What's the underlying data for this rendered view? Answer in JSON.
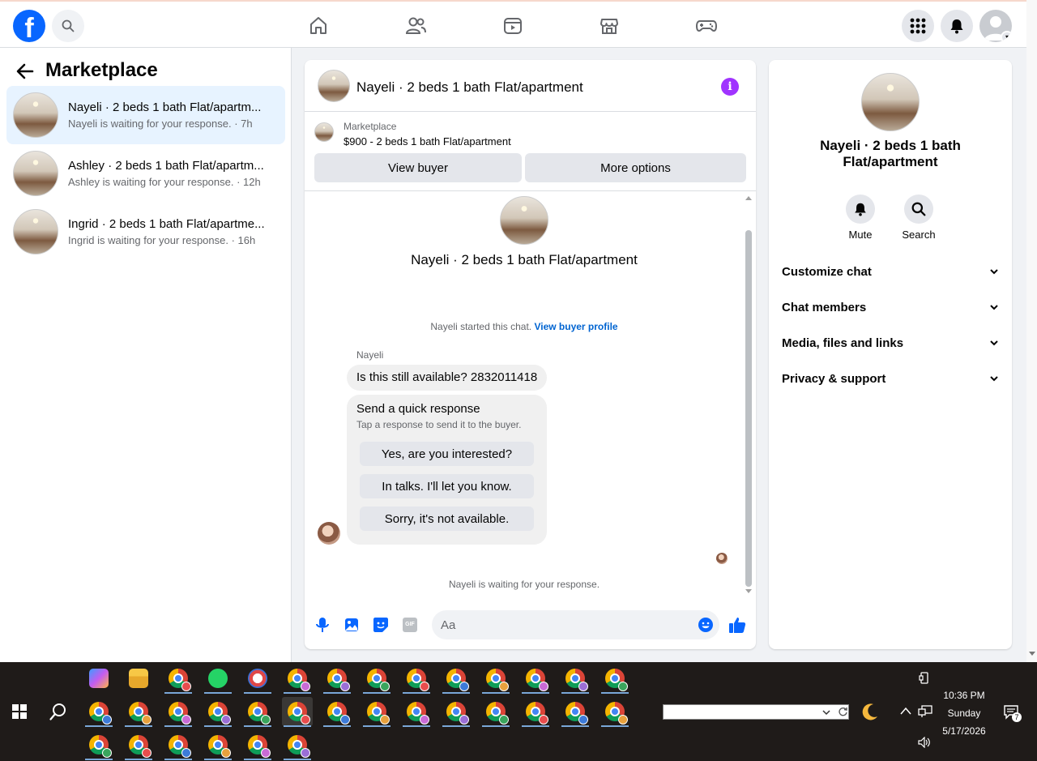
{
  "topbar": {
    "logo_letter": "f",
    "nav": [
      "home-icon",
      "friends-icon",
      "video-icon",
      "marketplace-icon",
      "gaming-icon"
    ]
  },
  "left": {
    "title": "Marketplace",
    "conversations": [
      {
        "title": "Nayeli · 2 beds 1 bath Flat/apartm...",
        "subtitle": "Nayeli is waiting for your response. · 7h",
        "active": true
      },
      {
        "title": "Ashley · 2 beds 1 bath Flat/apartm...",
        "subtitle": "Ashley is waiting for your response. · 12h",
        "active": false
      },
      {
        "title": "Ingrid · 2 beds 1 bath Flat/apartme...",
        "subtitle": "Ingrid is waiting for your response. · 16h",
        "active": false
      }
    ]
  },
  "chat": {
    "header_title": "Nayeli · 2 beds 1 bath Flat/apartment",
    "marketplace_label": "Marketplace",
    "listing": "$900 - 2 beds 1 bath Flat/apartment",
    "view_buyer": "View buyer",
    "more_options": "More options",
    "conversation_name": "Nayeli · 2 beds 1 bath Flat/apartment",
    "started_text": "Nayeli started this chat. ",
    "view_profile": "View buyer profile",
    "sender": "Nayeli",
    "message": "Is this still available? 2832011418",
    "quick_title": "Send a quick response",
    "quick_sub": "Tap a response to send it to the buyer.",
    "quick_responses": [
      "Yes, are you interested?",
      "In talks. I'll let you know.",
      "Sorry, it's not available."
    ],
    "waiting": "Nayeli is waiting for your response.",
    "input_placeholder": "Aa",
    "gif_label": "GIF"
  },
  "info": {
    "name": "Nayeli · 2 beds 1 bath Flat/apartment",
    "actions": [
      "Mute",
      "Search"
    ],
    "rows": [
      "Customize chat",
      "Chat members",
      "Media, files and links",
      "Privacy & support"
    ]
  },
  "taskbar": {
    "time": "10:36 PM",
    "day": "Sunday",
    "date": "5/17/2026",
    "notification_count": "7"
  },
  "colors": {
    "brand": "#0866ff",
    "accent": "#a033ff",
    "link": "#0064d1",
    "active_bg": "#e7f3ff"
  }
}
